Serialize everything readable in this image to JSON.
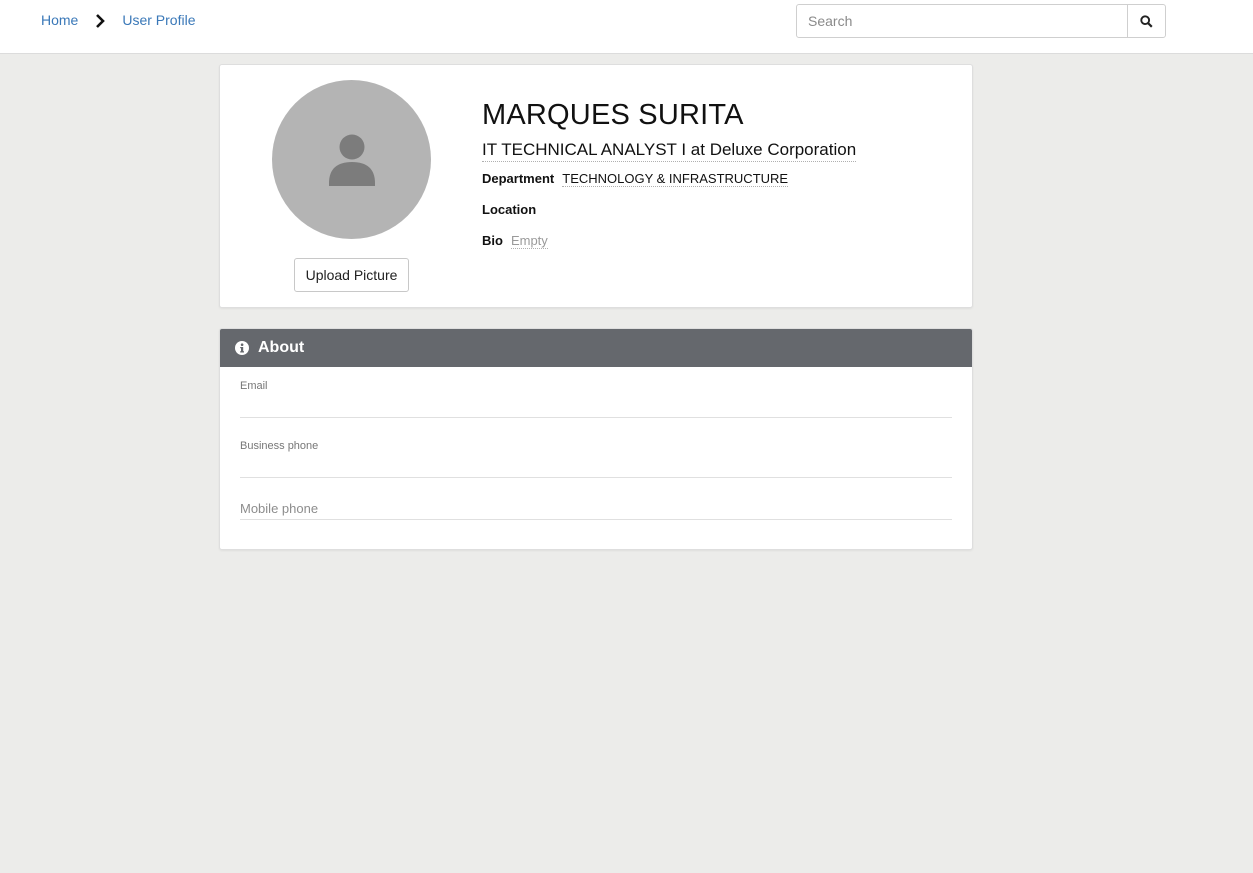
{
  "breadcrumb": {
    "home": "Home",
    "current": "User Profile"
  },
  "search": {
    "placeholder": "Search"
  },
  "profile": {
    "name": "MARQUES SURITA",
    "title": "IT TECHNICAL ANALYST I at Deluxe Corporation",
    "department_label": "Department",
    "department_value": "TECHNOLOGY & INFRASTRUCTURE",
    "location_label": "Location",
    "bio_label": "Bio",
    "bio_value": "Empty",
    "upload_label": "Upload Picture"
  },
  "about": {
    "heading": "About",
    "email_label": "Email",
    "business_phone_label": "Business phone",
    "mobile_phone_placeholder": "Mobile phone"
  },
  "colors": {
    "link": "#3a78b8",
    "header_bg": "#65686d",
    "avatar_bg": "#b4b4b4"
  }
}
